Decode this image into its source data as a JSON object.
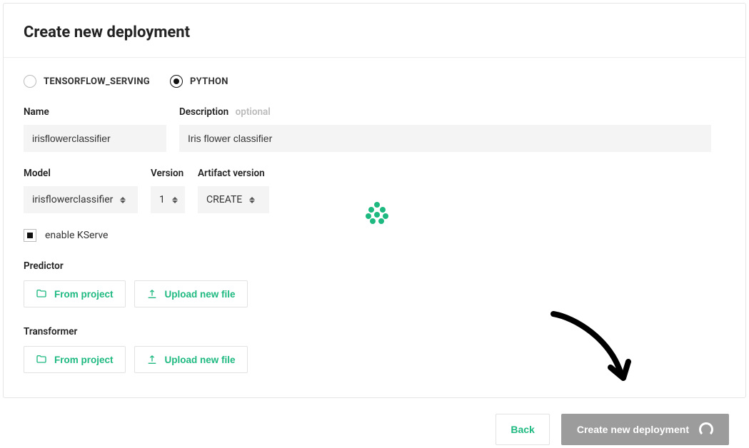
{
  "header": {
    "title": "Create new deployment"
  },
  "serving_type": {
    "options": [
      {
        "label": "TENSORFLOW_SERVING",
        "selected": false
      },
      {
        "label": "PYTHON",
        "selected": true
      }
    ]
  },
  "name": {
    "label": "Name",
    "value": "irisflowerclassifier"
  },
  "description": {
    "label": "Description",
    "optional_hint": "optional",
    "value": "Iris flower classifier"
  },
  "model": {
    "label": "Model",
    "selected": "irisflowerclassifier"
  },
  "version": {
    "label": "Version",
    "selected": "1"
  },
  "artifact_version": {
    "label": "Artifact version",
    "selected": "CREATE"
  },
  "kserve": {
    "label": "enable KServe",
    "checked": true
  },
  "predictor": {
    "label": "Predictor",
    "from_project": "From project",
    "upload": "Upload new file"
  },
  "transformer": {
    "label": "Transformer",
    "from_project": "From project",
    "upload": "Upload new file"
  },
  "footer": {
    "back": "Back",
    "create": "Create new deployment"
  }
}
